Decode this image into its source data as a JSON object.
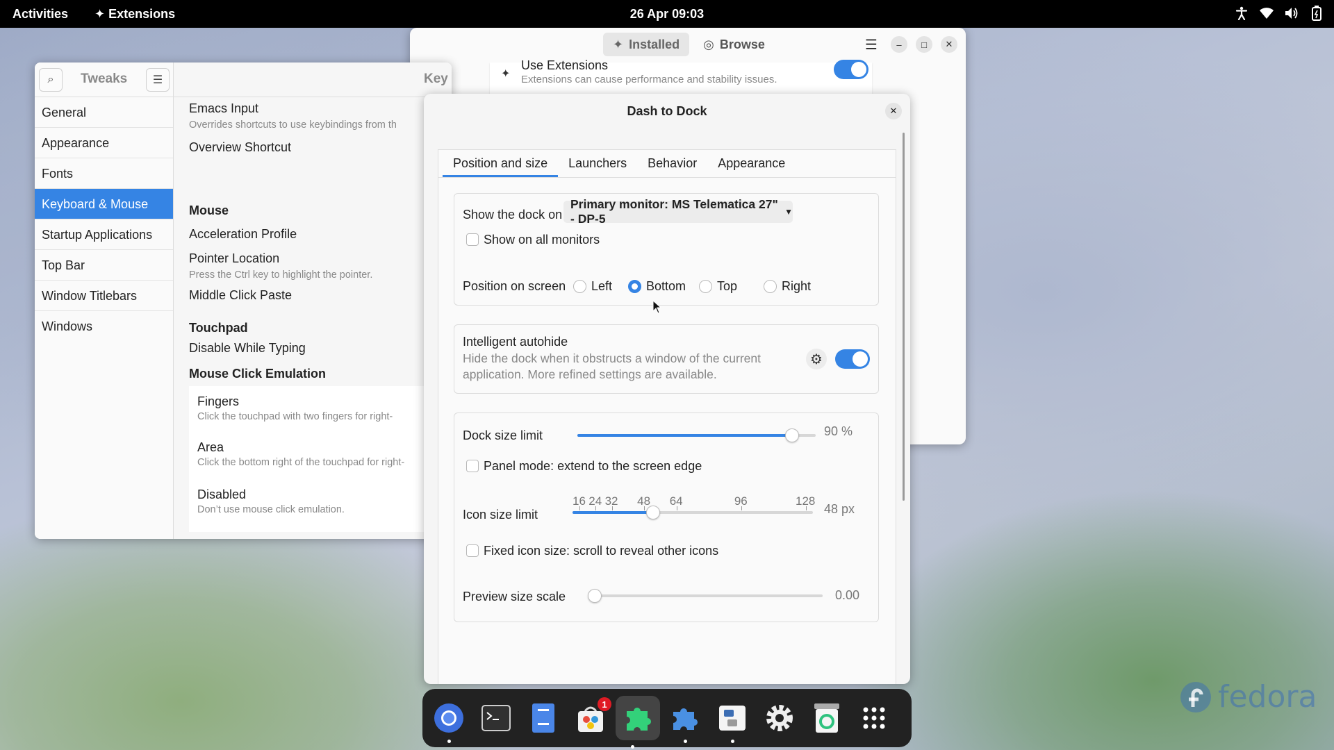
{
  "topbar": {
    "activities": "Activities",
    "app_menu": "Extensions",
    "clock": "26 Apr  09:03"
  },
  "extensions_window": {
    "tabs": [
      "Installed",
      "Browse"
    ],
    "row_title": "Use Extensions",
    "row_subtitle": "Extensions can cause performance and stability issues.",
    "use_extensions_enabled": true
  },
  "tweaks": {
    "title": "Tweaks",
    "header_partial": "Key",
    "sidebar": [
      "General",
      "Appearance",
      "Fonts",
      "Keyboard & Mouse",
      "Startup Applications",
      "Top Bar",
      "Window Titlebars",
      "Windows"
    ],
    "selected": "Keyboard & Mouse",
    "emacs_title": "Emacs Input",
    "emacs_sub": "Overrides shortcuts to use keybindings from th",
    "overview_shortcut": "Overview Shortcut",
    "mouse_heading": "Mouse",
    "accel_profile": "Acceleration Profile",
    "pointer_location": "Pointer Location",
    "pointer_location_sub": "Press the Ctrl key to highlight the pointer.",
    "middle_click": "Middle Click Paste",
    "touchpad_heading": "Touchpad",
    "disable_typing": "Disable While Typing",
    "click_emulation_heading": "Mouse Click Emulation",
    "fingers": "Fingers",
    "fingers_sub": "Click the touchpad with two fingers for right-",
    "area": "Area",
    "area_sub": "Click the bottom right of the touchpad for right-",
    "disabled": "Disabled",
    "disabled_sub": "Don’t use mouse click emulation."
  },
  "dash_to_dock": {
    "title": "Dash to Dock",
    "tabs": [
      "Position and size",
      "Launchers",
      "Behavior",
      "Appearance"
    ],
    "active_tab": "Position and size",
    "show_dock_on_label": "Show the dock on",
    "monitor_value": "Primary monitor: MS Telematica 27\" - DP-5",
    "show_all_monitors": "Show on all monitors",
    "show_all_monitors_checked": false,
    "position_label": "Position on screen",
    "positions": [
      "Left",
      "Bottom",
      "Top",
      "Right"
    ],
    "position_selected": "Bottom",
    "autohide_title": "Intelligent autohide",
    "autohide_sub": "Hide the dock when it obstructs a window of the current application. More refined settings are available.",
    "autohide_enabled": true,
    "dock_size_label": "Dock size limit",
    "dock_size_value": "90 %",
    "dock_size_fraction": 0.9,
    "panel_mode": "Panel mode: extend to the screen edge",
    "icon_size_label": "Icon size limit",
    "icon_size_value": "48 px",
    "icon_size_ticks": [
      "16",
      "24",
      "32",
      "48",
      "64",
      "96",
      "128"
    ],
    "fixed_icon": "Fixed icon size: scroll to reveal other icons",
    "preview_label": "Preview size scale",
    "preview_value": "0.00"
  },
  "dock": {
    "apps": [
      "chromium-icon",
      "terminal-icon",
      "text-editor-icon",
      "software-center-icon",
      "extensions-app-icon",
      "extension-manager-icon",
      "fedora-media-writer-icon",
      "settings-icon",
      "recycle-bin-icon",
      "app-grid-icon"
    ],
    "software_badge": "1"
  },
  "wallpaper_logo": "fedora",
  "colors": {
    "accent": "#3584e4",
    "topbar": "#000000",
    "dock": "#222222"
  }
}
